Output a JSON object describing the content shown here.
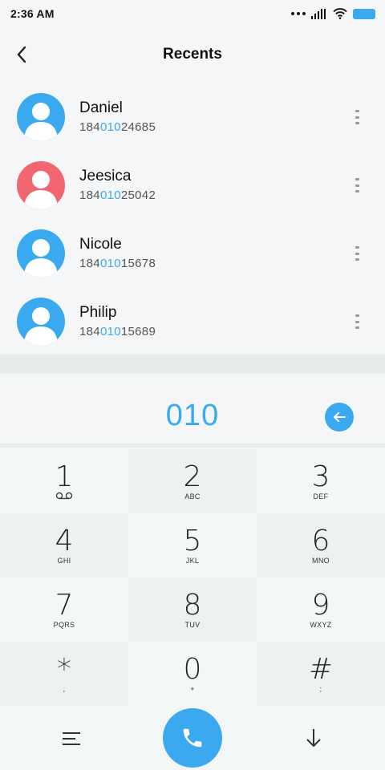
{
  "status_bar": {
    "time": "2:36 AM",
    "icons": [
      "more-dots-icon",
      "signal-icon",
      "wifi-icon",
      "battery-icon"
    ]
  },
  "header": {
    "title": "Recents",
    "back_icon": "chevron-left-icon"
  },
  "contacts": [
    {
      "name": "Daniel",
      "number_prefix": "184",
      "number_match": "010",
      "number_suffix": "24685",
      "avatar_color": "#3aa9ef"
    },
    {
      "name": "Jeesica",
      "number_prefix": "184",
      "number_match": "010",
      "number_suffix": "25042",
      "avatar_color": "#f2666f"
    },
    {
      "name": "Nicole",
      "number_prefix": "184",
      "number_match": "010",
      "number_suffix": "15678",
      "avatar_color": "#3aa9ef"
    },
    {
      "name": "Philip",
      "number_prefix": "184",
      "number_match": "010",
      "number_suffix": "15689",
      "avatar_color": "#3aa9ef"
    }
  ],
  "dialer": {
    "entered_digits": "010",
    "backspace_icon": "arrow-left-circle-icon"
  },
  "keypad": [
    {
      "digit": "1",
      "letters": "",
      "icon": "voicemail-icon"
    },
    {
      "digit": "2",
      "letters": "ABC"
    },
    {
      "digit": "3",
      "letters": "DEF"
    },
    {
      "digit": "4",
      "letters": "GHI"
    },
    {
      "digit": "5",
      "letters": "JKL"
    },
    {
      "digit": "6",
      "letters": "MNO"
    },
    {
      "digit": "7",
      "letters": "PQRS"
    },
    {
      "digit": "8",
      "letters": "TUV"
    },
    {
      "digit": "9",
      "letters": "WXYZ"
    },
    {
      "digit": "*",
      "letters": ","
    },
    {
      "digit": "0",
      "letters": "+"
    },
    {
      "digit": "#",
      "letters": ";"
    }
  ],
  "bottom_bar": {
    "menu_icon": "menu-icon",
    "call_icon": "phone-icon",
    "collapse_icon": "arrow-down-icon"
  },
  "colors": {
    "accent": "#3aa9ef",
    "avatar_red": "#f2666f"
  }
}
